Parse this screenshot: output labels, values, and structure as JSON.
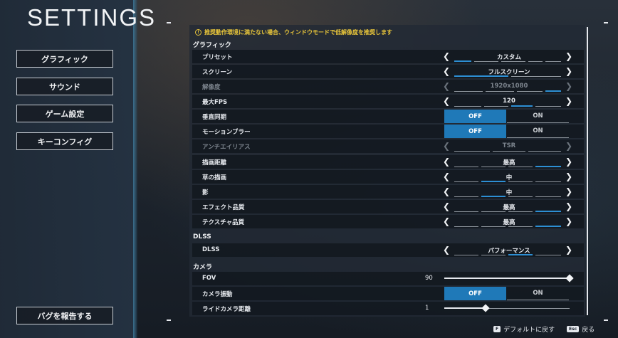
{
  "title": "SETTINGS",
  "nav": [
    {
      "label": "グラフィック"
    },
    {
      "label": "サウンド"
    },
    {
      "label": "ゲーム設定"
    },
    {
      "label": "キーコンフィグ"
    }
  ],
  "report_label": "バグを報告する",
  "warning": "推奨動作環境に満たない場合、ウィンドウモードで低解像度を推奨します",
  "sections": {
    "graphics": "グラフィック",
    "dlss": "DLSS",
    "camera": "カメラ"
  },
  "rows": {
    "preset": {
      "label": "プリセット",
      "value": "カスタム"
    },
    "screen": {
      "label": "スクリーン",
      "value": "フルスクリーン"
    },
    "resolution": {
      "label": "解像度",
      "value": "1920x1080"
    },
    "max_fps": {
      "label": "最大FPS",
      "value": "120"
    },
    "vsync": {
      "label": "垂直同期",
      "off": "OFF",
      "on": "ON"
    },
    "motion_blur": {
      "label": "モーションブラー",
      "off": "OFF",
      "on": "ON"
    },
    "antialias": {
      "label": "アンチエイリアス",
      "value": "TSR"
    },
    "draw_distance": {
      "label": "描画距離",
      "value": "最高"
    },
    "grass": {
      "label": "草の描画",
      "value": "中"
    },
    "shadow": {
      "label": "影",
      "value": "中"
    },
    "effect": {
      "label": "エフェクト品質",
      "value": "最高"
    },
    "texture": {
      "label": "テクスチャ品質",
      "value": "最高"
    },
    "dlss": {
      "label": "DLSS",
      "value": "パフォーマンス"
    },
    "fov": {
      "label": "FOV",
      "value": "90",
      "fraction": 1.0
    },
    "camera_shake": {
      "label": "カメラ振動",
      "off": "OFF",
      "on": "ON"
    },
    "ride_camera": {
      "label": "ライドカメラ距離",
      "value": "1",
      "fraction": 0.33
    }
  },
  "footer": {
    "default_key": "F",
    "default_label": "デフォルトに戻す",
    "back_key": "Esc",
    "back_label": "戻る"
  },
  "colors": {
    "accent": "#1f79b8",
    "warning": "#e8c53a"
  },
  "icons": {
    "arrow_left": "chevron-left-icon",
    "arrow_right": "chevron-right-icon",
    "warning": "warning-icon"
  }
}
